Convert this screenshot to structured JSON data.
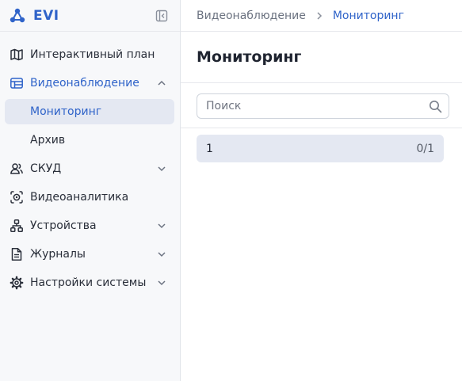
{
  "brand": {
    "name": "EVI"
  },
  "sidebar": {
    "items": [
      {
        "label": "Интерактивный план",
        "icon": "map-icon",
        "expandable": false,
        "expanded": false,
        "active": false
      },
      {
        "label": "Видеонаблюдение",
        "icon": "video-icon",
        "expandable": true,
        "expanded": true,
        "active": true,
        "children": [
          {
            "label": "Мониторинг",
            "selected": true
          },
          {
            "label": "Архив",
            "selected": false
          }
        ]
      },
      {
        "label": "СКУД",
        "icon": "users-icon",
        "expandable": true,
        "expanded": false,
        "active": false
      },
      {
        "label": "Видеоаналитика",
        "icon": "analytics-icon",
        "expandable": false,
        "expanded": false,
        "active": false
      },
      {
        "label": "Устройства",
        "icon": "devices-icon",
        "expandable": true,
        "expanded": false,
        "active": false
      },
      {
        "label": "Журналы",
        "icon": "journal-icon",
        "expandable": true,
        "expanded": false,
        "active": false
      },
      {
        "label": "Настройки системы",
        "icon": "gear-icon",
        "expandable": true,
        "expanded": false,
        "active": false
      }
    ]
  },
  "breadcrumb": {
    "parent": "Видеонаблюдение",
    "current": "Мониторинг"
  },
  "main": {
    "title": "Мониторинг",
    "search": {
      "placeholder": "Поиск",
      "value": ""
    },
    "list": [
      {
        "name": "1",
        "count": "0/1"
      }
    ]
  },
  "colors": {
    "accent": "#2f63c9",
    "selected_bg": "#e4e8f2",
    "sidebar_bg": "#f7f8fa"
  }
}
